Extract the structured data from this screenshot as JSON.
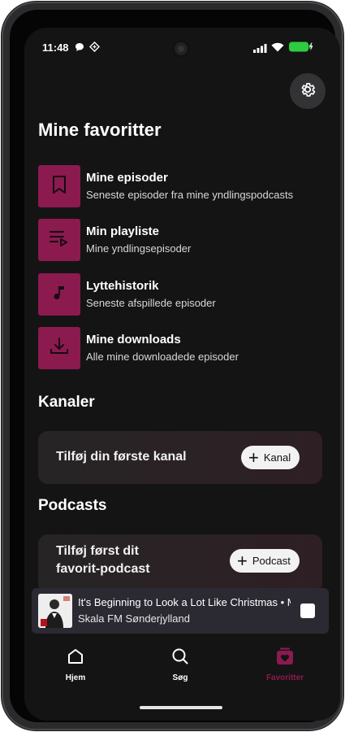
{
  "status_bar": {
    "time": "11:48"
  },
  "page": {
    "title": "Mine favoritter"
  },
  "favorites": [
    {
      "title": "Mine episoder",
      "subtitle": "Seneste episoder fra mine yndlingspodcasts",
      "icon": "bookmark-icon"
    },
    {
      "title": "Min playliste",
      "subtitle": "Mine yndlingsepisoder",
      "icon": "playlist-icon"
    },
    {
      "title": "Lyttehistorik",
      "subtitle": "Seneste afspillede episoder",
      "icon": "music-note-icon"
    },
    {
      "title": "Mine downloads",
      "subtitle": "Alle mine downloadede episoder",
      "icon": "download-icon"
    }
  ],
  "channels": {
    "heading": "Kanaler",
    "empty_text": "Tilføj din første kanal",
    "add_label": "Kanal"
  },
  "podcasts": {
    "heading": "Podcasts",
    "empty_text_line1": "Tilføj først dit",
    "empty_text_line2": "favorit-podcast",
    "add_label": "Podcast"
  },
  "mini_player": {
    "title": "It's Beginning to Look a Lot Like Christmas • Michael Bublé",
    "station": "Skala FM Sønderjylland"
  },
  "bottom_nav": [
    {
      "label": "Hjem",
      "icon": "home-icon"
    },
    {
      "label": "Søg",
      "icon": "search-icon"
    },
    {
      "label": "Favoritter",
      "icon": "favorites-heart-icon",
      "active": true
    }
  ],
  "colors": {
    "accent": "#8b1a4f",
    "background": "#141414",
    "card": "#2b2225",
    "miniplayer": "#2b2a33"
  }
}
